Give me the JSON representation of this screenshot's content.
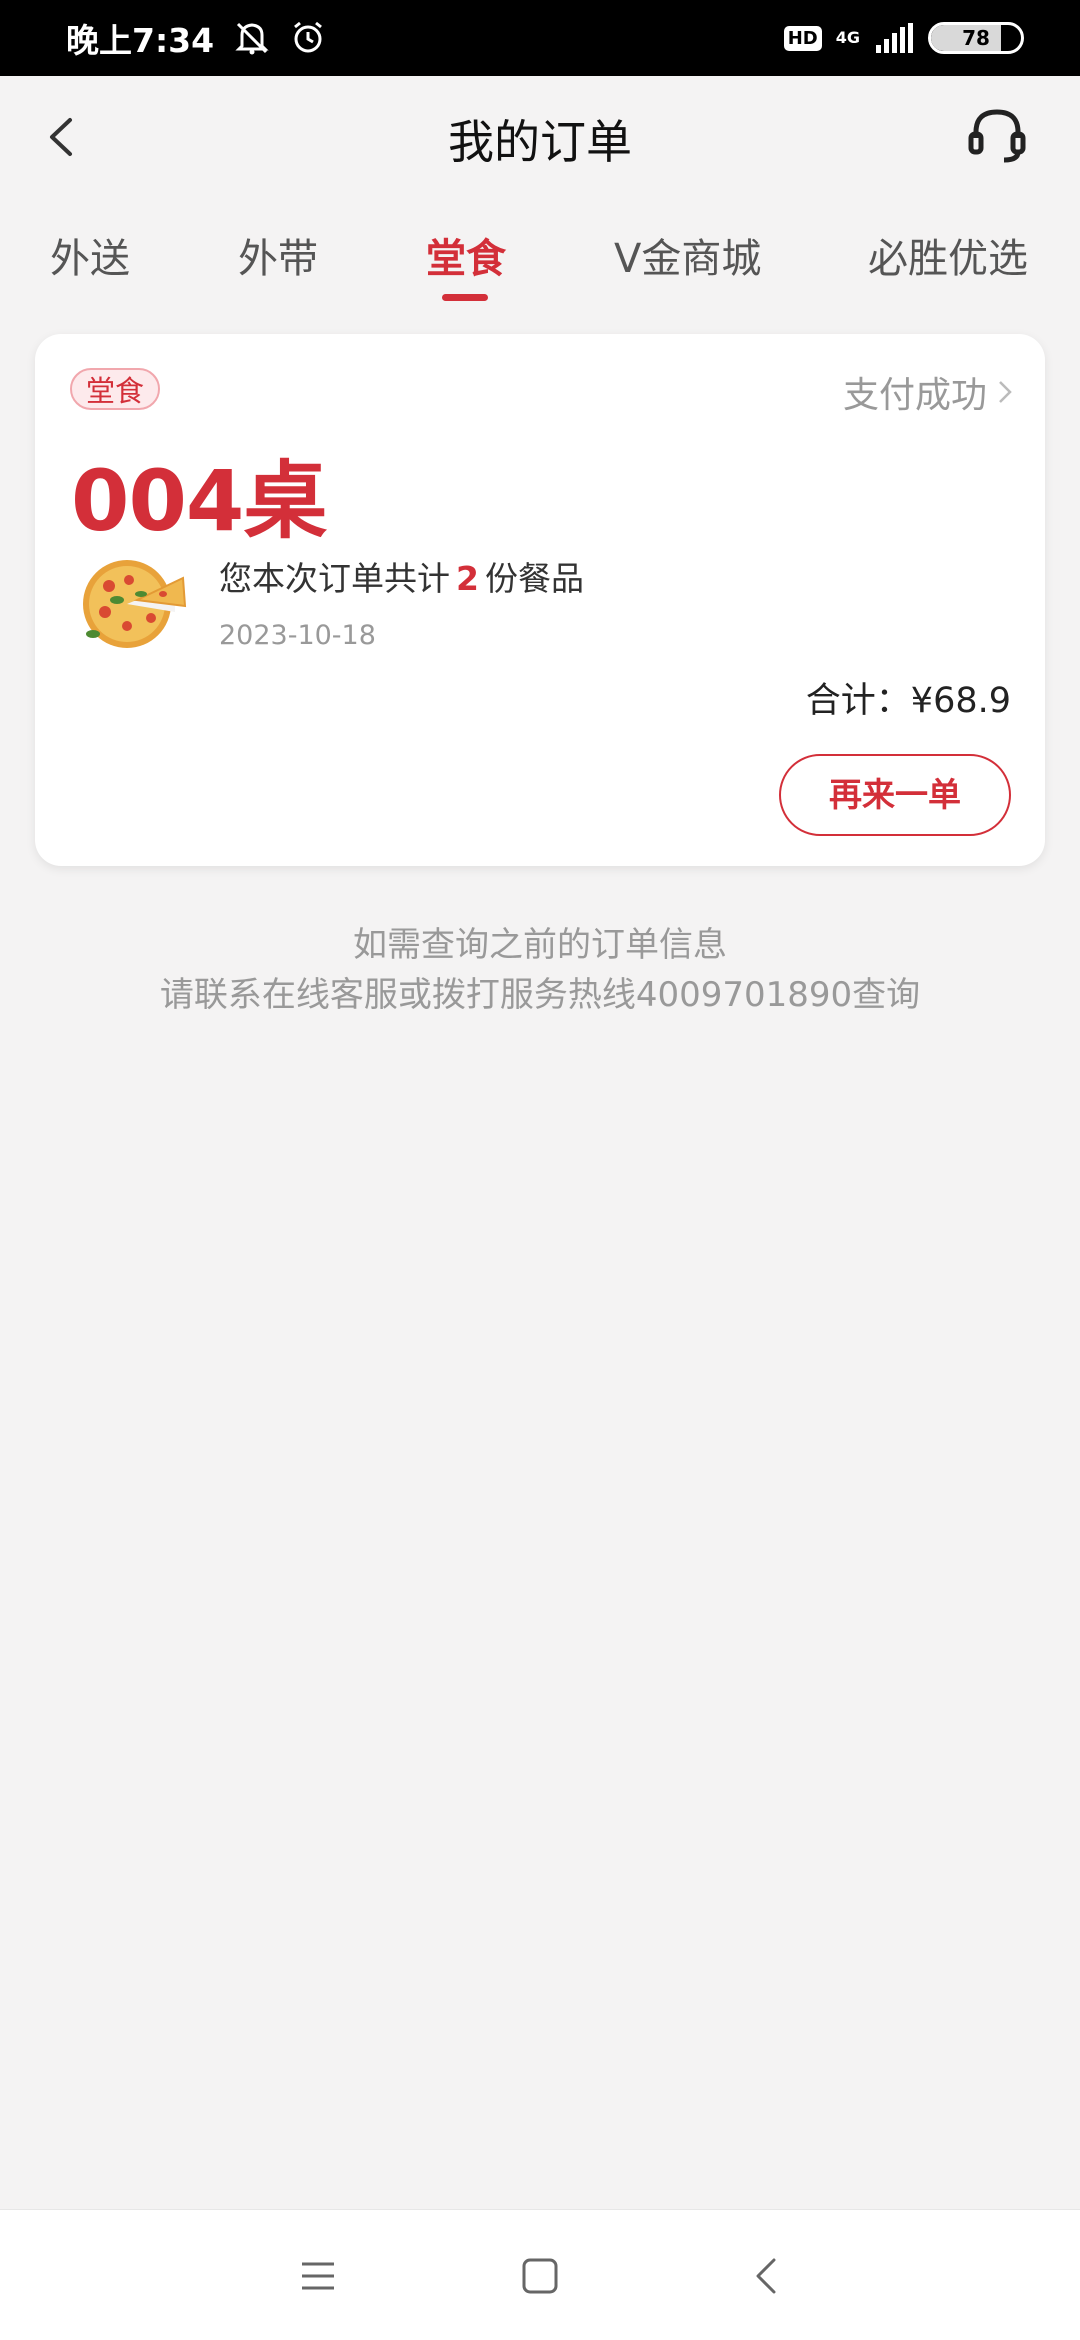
{
  "status_bar": {
    "time": "晚上7:34",
    "hd_label": "HD",
    "network_label": "4G",
    "battery_level": "78",
    "icons": [
      "mute-icon",
      "alarm-icon",
      "hd-icon",
      "signal-icon",
      "battery-icon"
    ]
  },
  "header": {
    "title": "我的订单",
    "back_icon": "chevron-left-icon",
    "service_icon": "headset-icon"
  },
  "tabs": {
    "items": [
      "外送",
      "外带",
      "堂食",
      "V金商城",
      "必胜优选"
    ],
    "active": "堂食"
  },
  "order": {
    "type_badge": "堂食",
    "status": "支付成功",
    "table_number": "004桌",
    "summary_prefix": "您本次订单共计",
    "item_count": "2",
    "summary_suffix": "份餐品",
    "date": "2023-10-18",
    "total": "合计：¥68.9",
    "reorder_label": "再来一单",
    "image_icon": "pizza-icon"
  },
  "note": {
    "line1": "如需查询之前的订单信息",
    "line2": "请联系在线客服或拨打服务热线4009701890查询"
  },
  "colors": {
    "accent": "#d32f39",
    "background": "#f4f3f3"
  }
}
